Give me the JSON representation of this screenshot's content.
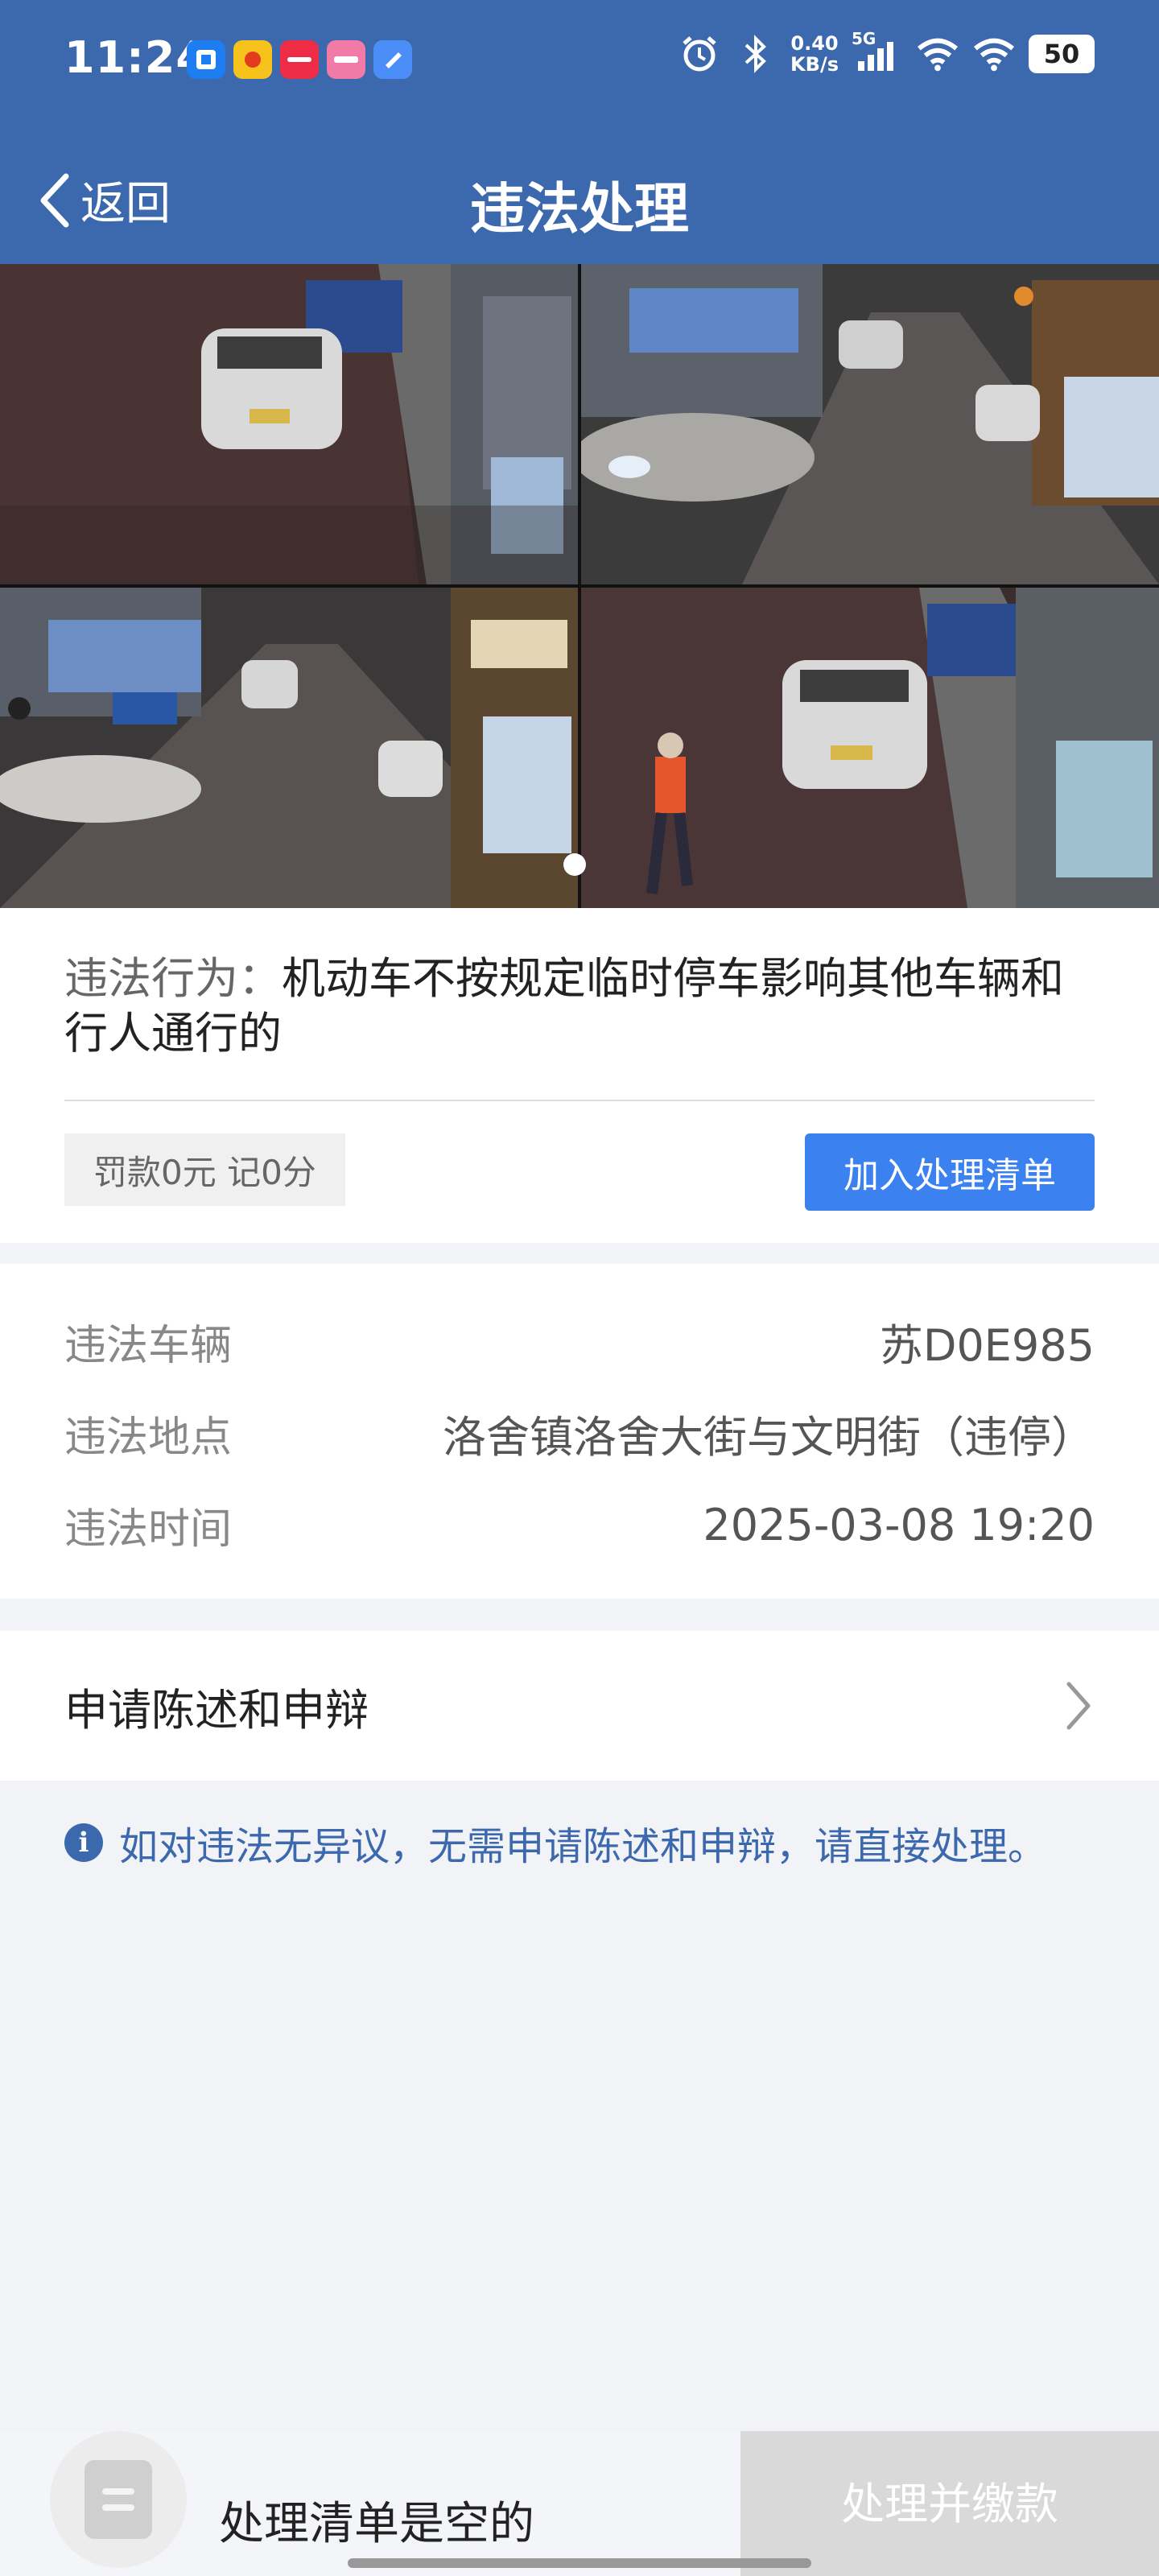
{
  "status_bar": {
    "time": "11:24",
    "net_speed_value": "0.40",
    "net_speed_unit": "KB/s",
    "network": "5G",
    "battery": "50",
    "app_icons": [
      {
        "name": "app-icon-1",
        "color": "#1e7df0"
      },
      {
        "name": "app-icon-2",
        "color": "#f6c21b"
      },
      {
        "name": "app-icon-3",
        "color": "#ef2c45"
      },
      {
        "name": "app-icon-4",
        "color": "#f27aa6"
      },
      {
        "name": "app-icon-5",
        "color": "#4b8ef7"
      }
    ]
  },
  "nav": {
    "back_label": "返回",
    "title": "违法处理"
  },
  "photos": {
    "count": 4,
    "current_index": 1
  },
  "violation": {
    "behavior_label": "违法行为：",
    "behavior_text": "机动车不按规定临时停车影响其他车辆和行人通行的",
    "fine_text": "罚款0元 记0分",
    "add_button": "加入处理清单"
  },
  "details": {
    "vehicle_label": "违法车辆",
    "vehicle_value": "苏D0E985",
    "location_label": "违法地点",
    "location_value": "洛舍镇洛舍大街与文明街（违停）",
    "time_label": "违法时间",
    "time_value": "2025-03-08 19:20"
  },
  "appeal": {
    "label": "申请陈述和申辩"
  },
  "tip": {
    "text": "如对违法无异议，无需申请陈述和申辩，请直接处理。"
  },
  "bottom": {
    "empty_text": "处理清单是空的",
    "pay_button": "处理并缴款"
  },
  "colors": {
    "header": "#3c68ad",
    "primary_button": "#3b82f0",
    "disabled_button": "#d9d9d9"
  }
}
